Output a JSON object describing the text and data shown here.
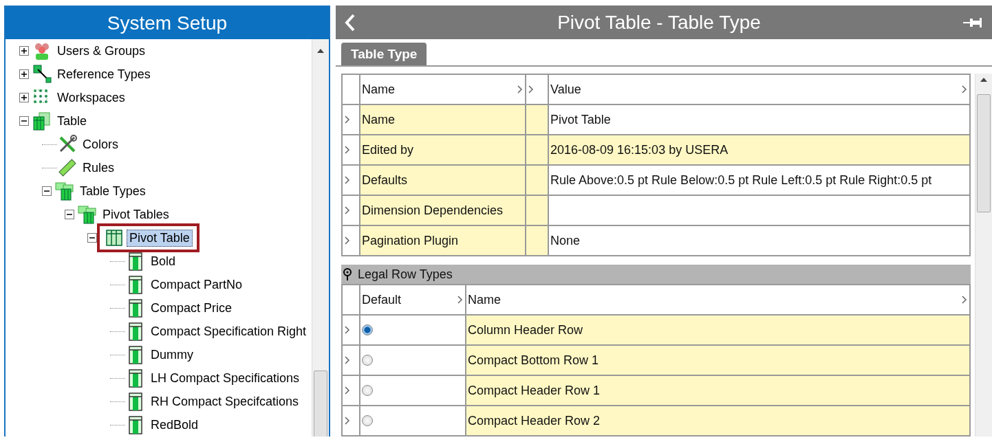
{
  "left_panel": {
    "title": "System Setup",
    "tree": [
      {
        "label": "Users & Groups",
        "kind": "users",
        "expanded": false,
        "selected": false
      },
      {
        "label": "Reference Types",
        "kind": "reference",
        "expanded": false,
        "selected": false
      },
      {
        "label": "Workspaces",
        "kind": "workspace",
        "expanded": false,
        "selected": false
      },
      {
        "label": "Table",
        "kind": "table",
        "expanded": true,
        "selected": false,
        "children": [
          {
            "label": "Colors",
            "kind": "tools",
            "selected": false
          },
          {
            "label": "Rules",
            "kind": "ruler",
            "selected": false
          },
          {
            "label": "Table Types",
            "kind": "stack",
            "expanded": true,
            "selected": false,
            "children": [
              {
                "label": "Pivot Tables",
                "kind": "stack",
                "expanded": true,
                "selected": false,
                "children": [
                  {
                    "label": "Pivot Table",
                    "kind": "grid",
                    "expanded": true,
                    "selected": true,
                    "children": [
                      {
                        "label": "Bold",
                        "kind": "row",
                        "selected": false
                      },
                      {
                        "label": "Compact PartNo",
                        "kind": "row",
                        "selected": false
                      },
                      {
                        "label": "Compact Price",
                        "kind": "row",
                        "selected": false
                      },
                      {
                        "label": "Compact Specification Right",
                        "kind": "row",
                        "selected": false
                      },
                      {
                        "label": "Dummy",
                        "kind": "row",
                        "selected": false
                      },
                      {
                        "label": "LH Compact Specifications",
                        "kind": "row",
                        "selected": false
                      },
                      {
                        "label": "RH Compact Specifcations",
                        "kind": "row",
                        "selected": false
                      },
                      {
                        "label": "RedBold",
                        "kind": "row",
                        "selected": false
                      }
                    ]
                  }
                ]
              }
            ]
          }
        ]
      }
    ]
  },
  "right_panel": {
    "title": "Pivot Table - Table Type",
    "tabs": [
      {
        "label": "Table Type",
        "selected": true
      }
    ],
    "properties": {
      "columns": [
        "Name",
        "Value"
      ],
      "rows": [
        {
          "name": "Name",
          "value": "Pivot Table",
          "selected": false
        },
        {
          "name": "Edited by",
          "value": "2016-08-09 16:15:03 by USERA",
          "selected": true
        },
        {
          "name": "Defaults",
          "value": "Rule Above:0.5 pt Rule Below:0.5 pt Rule Left:0.5 pt Rule Right:0.5 pt",
          "selected": false
        },
        {
          "name": "Dimension Dependencies",
          "selected": false
        },
        {
          "name": "Pagination Plugin",
          "value": "None",
          "selected": false
        }
      ]
    },
    "legal_row_types": {
      "title": "Legal Row Types",
      "columns": [
        "Default",
        "Name"
      ],
      "rows": [
        {
          "name": "Column Header Row",
          "selected": true
        },
        {
          "name": "Compact Bottom Row 1",
          "selected": false
        },
        {
          "name": "Compact Header Row 1",
          "selected": false
        },
        {
          "name": "Compact Header Row 2",
          "selected": false
        }
      ]
    }
  }
}
